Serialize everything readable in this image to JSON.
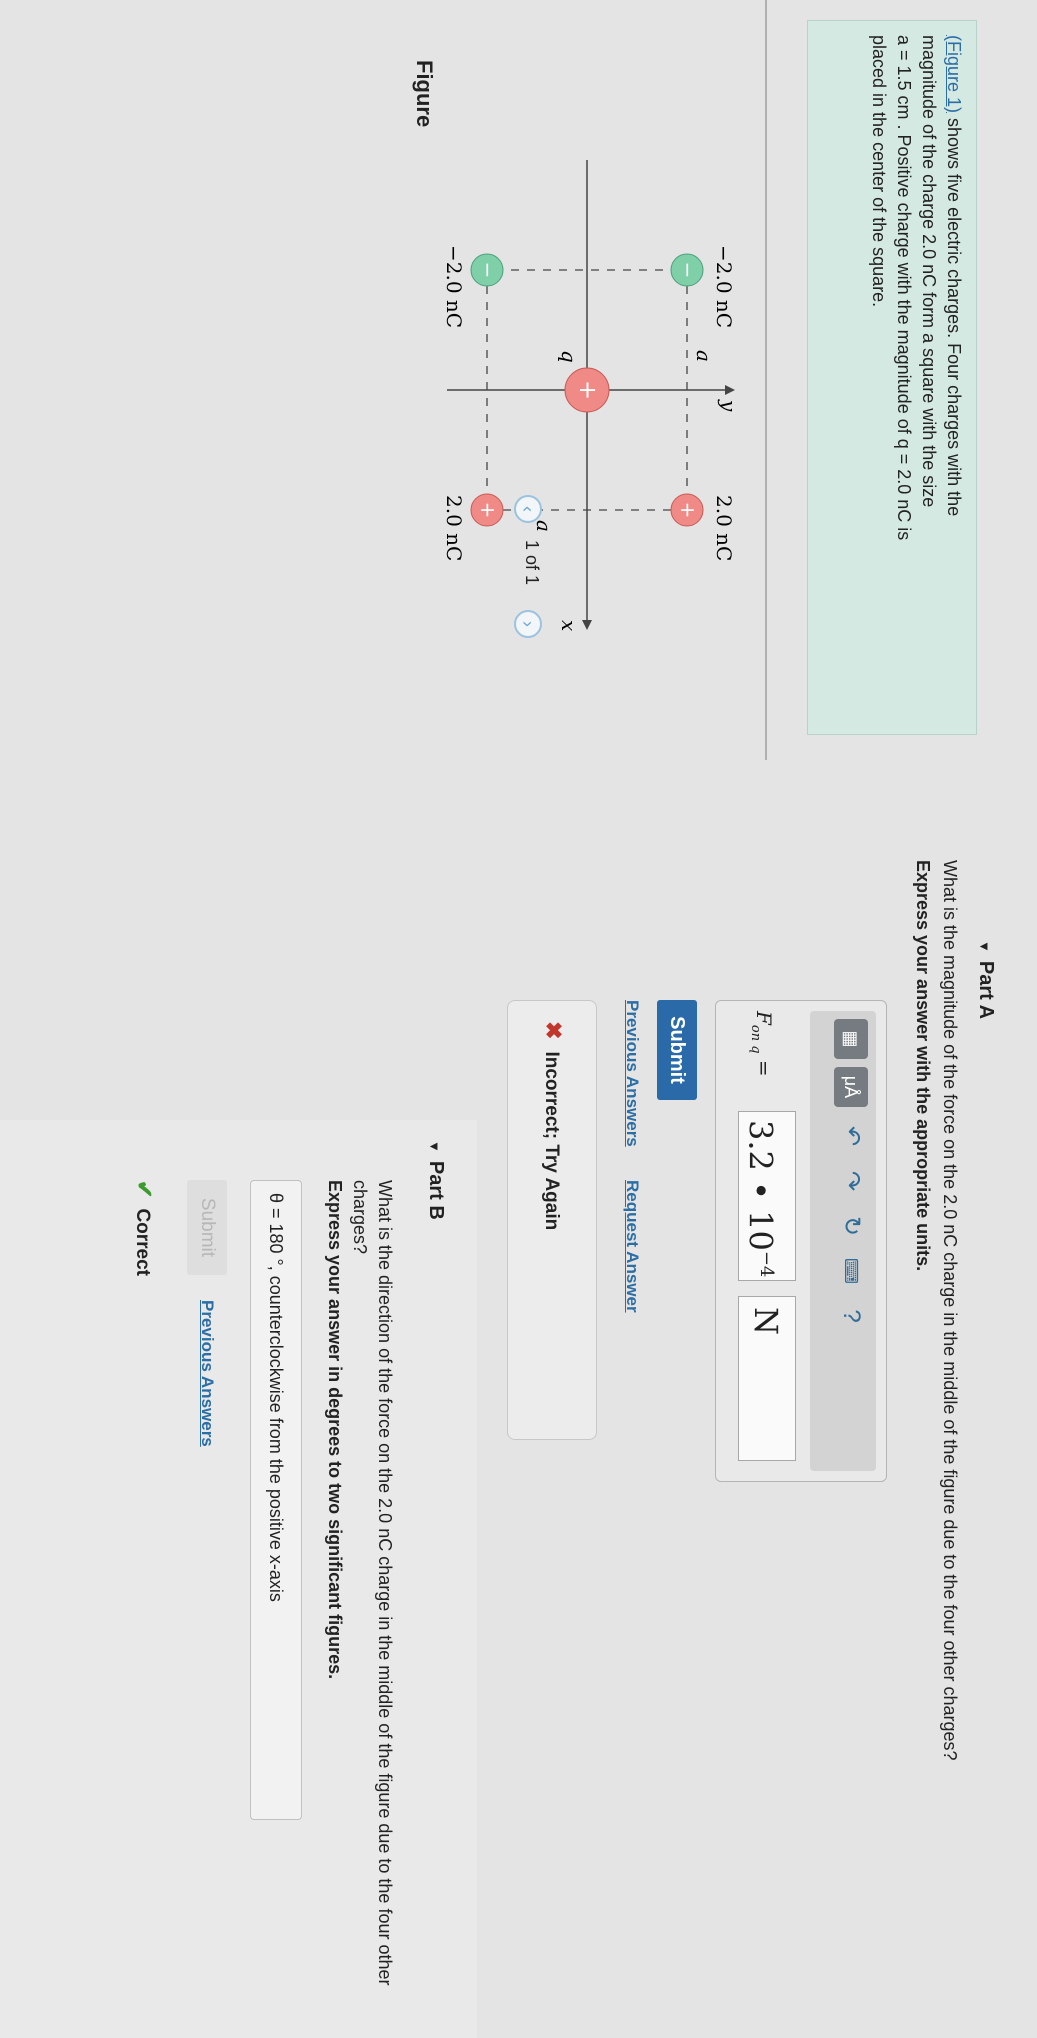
{
  "intro": {
    "fig_link": "(Figure 1)",
    "line1": " shows five electric charges. Four charges with the",
    "line2": "magnitude of the charge 2.0 nC form a square with the size",
    "line3": "a = 1.5 cm . Positive charge with the magnitude of q = 2.0 nC is",
    "line4": "placed in the center of the square."
  },
  "figure": {
    "label": "Figure",
    "count": "1 of 1",
    "prev_icon": "chevron-left-icon",
    "next_icon": "chevron-right-icon",
    "axis_y": "y",
    "axis_x": "x",
    "side_a_top": "a",
    "side_a_right": "a",
    "center_q": "q",
    "charge_tl": "−2.0 nC",
    "charge_tr": "2.0 nC",
    "charge_bl": "−2.0 nC",
    "charge_br": "2.0 nC",
    "neg_sign": "−",
    "pos_sign": "+",
    "colors": {
      "negative": "#7fcfa8",
      "positive": "#ef8a86"
    }
  },
  "partA": {
    "title": "Part A",
    "question": "What is the magnitude of the force on the 2.0 nC charge in the middle of the figure due to the four other charges?",
    "instruction": "Express your answer with the appropriate units.",
    "toolbar": {
      "templates_icon": "templates-icon",
      "units_label": "μÅ",
      "undo_icon": "undo-icon",
      "redo_icon": "redo-icon",
      "reset_icon": "reset-icon",
      "keyboard_icon": "keyboard-icon",
      "help_label": "?"
    },
    "formula_label": "F",
    "formula_sub": "on q",
    "equals": " =",
    "value_mantissa": "3.2 • 10",
    "value_exponent": "−4",
    "unit": "N",
    "submit": "Submit",
    "previous_answers": "Previous Answers",
    "request_answer": "Request Answer",
    "feedback": "Incorrect; Try Again"
  },
  "partB": {
    "title": "Part B",
    "question": "What is the direction of the force on the 2.0 nC charge in the middle of the figure due to the four other charges?",
    "instruction": "Express your answer in degrees to two significant figures.",
    "answer_text": "θ =  180  °, counterclockwise from the positive x-axis",
    "submit": "Submit",
    "previous_answers": "Previous Answers",
    "feedback": "Correct"
  }
}
